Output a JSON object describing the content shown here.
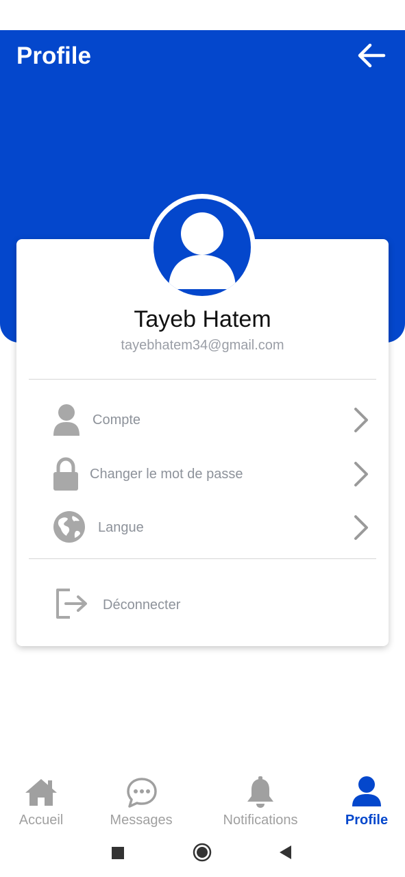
{
  "header": {
    "title": "Profile",
    "back_icon": "arrow-left-icon"
  },
  "colors": {
    "primary": "#0447cc",
    "muted": "#a0a0a0",
    "active_nav": "#0447cc"
  },
  "profile": {
    "name": "Tayeb Hatem",
    "email": "tayebhatem34@gmail.com",
    "avatar_icon": "user-avatar-icon"
  },
  "menu": {
    "items": [
      {
        "label": "Compte",
        "icon": "user-icon"
      },
      {
        "label": "Changer le mot de passe",
        "icon": "lock-icon"
      },
      {
        "label": "Langue",
        "icon": "globe-icon"
      }
    ],
    "logout": {
      "label": "Déconnecter",
      "icon": "logout-icon"
    }
  },
  "bottom_nav": {
    "items": [
      {
        "label": "Accueil",
        "icon": "home-icon",
        "active": false
      },
      {
        "label": "Messages",
        "icon": "chat-icon",
        "active": false
      },
      {
        "label": "Notifications",
        "icon": "bell-icon",
        "active": false
      },
      {
        "label": "Profile",
        "icon": "profile-icon",
        "active": true
      }
    ]
  },
  "system_nav": {
    "buttons": [
      "recents-icon",
      "home-circle-icon",
      "back-triangle-icon"
    ]
  }
}
